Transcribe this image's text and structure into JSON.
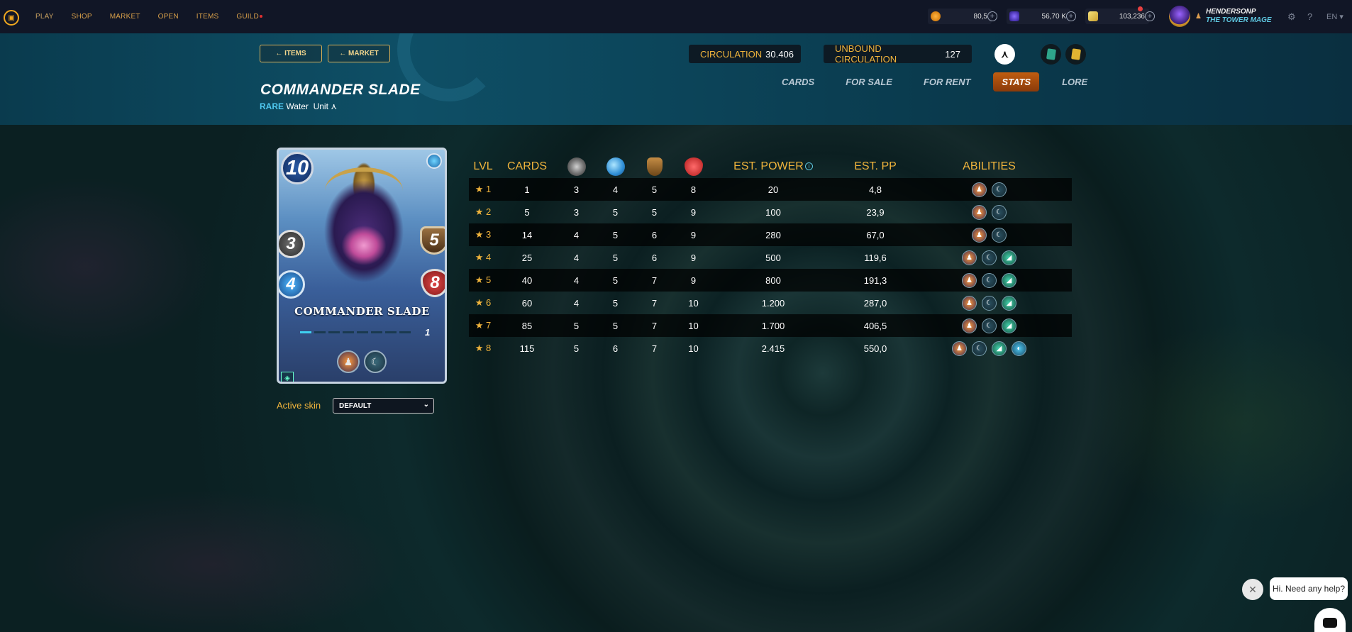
{
  "nav": {
    "items": [
      "PLAY",
      "SHOP",
      "MARKET",
      "OPEN",
      "ITEMS",
      "GUILD"
    ]
  },
  "balances": {
    "credits": "80,5",
    "dec": "56,70 K",
    "sps": "103,236"
  },
  "user": {
    "name": "HENDERSONP",
    "title": "THE TOWER MAGE"
  },
  "language": "EN",
  "header": {
    "back_items": "ITEMS",
    "back_market": "MARKET",
    "circulation_label": "CIRCULATION",
    "circulation_value": "30.406",
    "unbound_label": "UNBOUND CIRCULATION",
    "unbound_value": "127",
    "card_name": "COMMANDER SLADE",
    "rarity": "RARE",
    "element": "Water",
    "type": "Unit",
    "tabs": [
      "CARDS",
      "FOR SALE",
      "FOR RENT",
      "STATS",
      "LORE"
    ],
    "active_tab": "STATS"
  },
  "card": {
    "mana": "10",
    "melee": "3",
    "magic": "4",
    "armor": "5",
    "health": "8",
    "name": "COMMANDER SLADE",
    "level": "1",
    "xp_progress": 0.11
  },
  "skin": {
    "label": "Active skin",
    "value": "DEFAULT"
  },
  "table": {
    "headers": {
      "lvl": "LVL",
      "cards": "CARDS",
      "power": "EST. POWER",
      "pp": "EST. PP",
      "abilities": "ABILITIES"
    },
    "rows": [
      {
        "lvl": "1",
        "cards": "1",
        "melee": "3",
        "magic": "4",
        "armor": "5",
        "health": "8",
        "power": "20",
        "pp": "4,8",
        "abilities": 2
      },
      {
        "lvl": "2",
        "cards": "5",
        "melee": "3",
        "magic": "5",
        "armor": "5",
        "health": "9",
        "power": "100",
        "pp": "23,9",
        "abilities": 2
      },
      {
        "lvl": "3",
        "cards": "14",
        "melee": "4",
        "magic": "5",
        "armor": "6",
        "health": "9",
        "power": "280",
        "pp": "67,0",
        "abilities": 2
      },
      {
        "lvl": "4",
        "cards": "25",
        "melee": "4",
        "magic": "5",
        "armor": "6",
        "health": "9",
        "power": "500",
        "pp": "119,6",
        "abilities": 3
      },
      {
        "lvl": "5",
        "cards": "40",
        "melee": "4",
        "magic": "5",
        "armor": "7",
        "health": "9",
        "power": "800",
        "pp": "191,3",
        "abilities": 3
      },
      {
        "lvl": "6",
        "cards": "60",
        "melee": "4",
        "magic": "5",
        "armor": "7",
        "health": "10",
        "power": "1.200",
        "pp": "287,0",
        "abilities": 3
      },
      {
        "lvl": "7",
        "cards": "85",
        "melee": "5",
        "magic": "5",
        "armor": "7",
        "health": "10",
        "power": "1.700",
        "pp": "406,5",
        "abilities": 3
      },
      {
        "lvl": "8",
        "cards": "115",
        "melee": "5",
        "magic": "6",
        "armor": "7",
        "health": "10",
        "power": "2.415",
        "pp": "550,0",
        "abilities": 4
      }
    ]
  },
  "chat": {
    "greeting": "Hi. Need any help?"
  }
}
